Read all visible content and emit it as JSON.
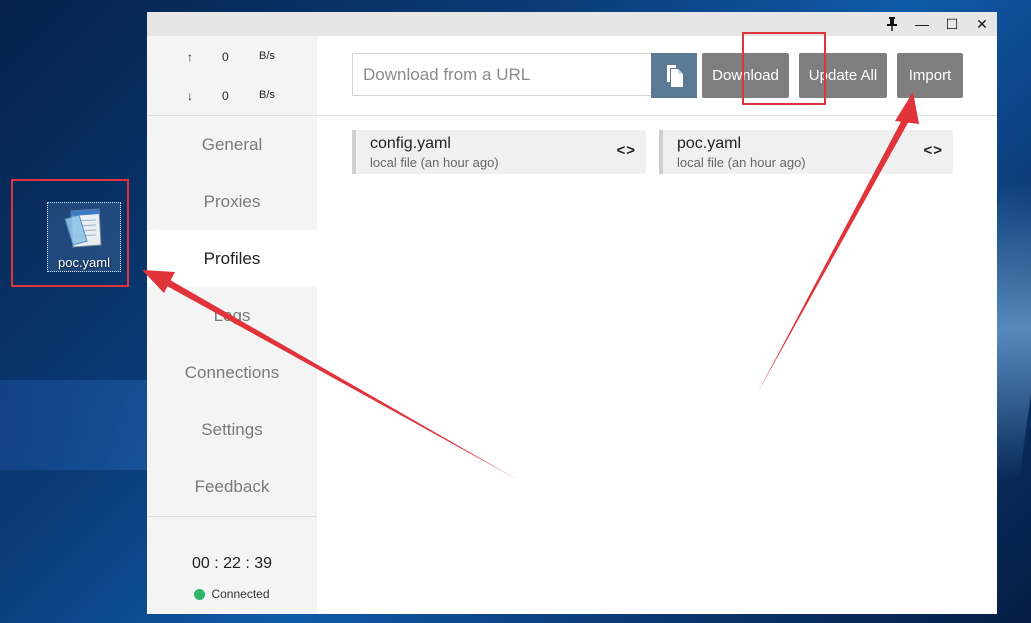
{
  "desktop": {
    "icon_label": "poc.yaml"
  },
  "titlebar": {
    "pin_icon": "pin-icon",
    "minimize_glyph": "—",
    "maximize_glyph": "☐",
    "close_glyph": "✕"
  },
  "sidebar": {
    "traffic": {
      "up_arrow": "↑",
      "up_value": "0",
      "up_unit": "B/s",
      "down_arrow": "↓",
      "down_value": "0",
      "down_unit": "B/s"
    },
    "items": [
      {
        "label": "General"
      },
      {
        "label": "Proxies"
      },
      {
        "label": "Profiles"
      },
      {
        "label": "Logs"
      },
      {
        "label": "Connections"
      },
      {
        "label": "Settings"
      },
      {
        "label": "Feedback"
      }
    ],
    "active_item": "Profiles",
    "timer": "00 : 22 : 39",
    "status": "Connected",
    "status_color": "#2fb56a"
  },
  "toolbar": {
    "url_placeholder": "Download from a URL",
    "paste_icon": "paste-icon",
    "download_label": "Download",
    "update_all_label": "Update All",
    "import_label": "Import"
  },
  "profiles": [
    {
      "name": "config.yaml",
      "subtitle": "local file (an hour ago)",
      "code_glyph": "<>"
    },
    {
      "name": "poc.yaml",
      "subtitle": "local file (an hour ago)",
      "code_glyph": "<>"
    }
  ],
  "colors": {
    "annotation_red": "#e0333a",
    "button_gray": "#7e7e7e",
    "paste_button": "#5a7a96"
  }
}
